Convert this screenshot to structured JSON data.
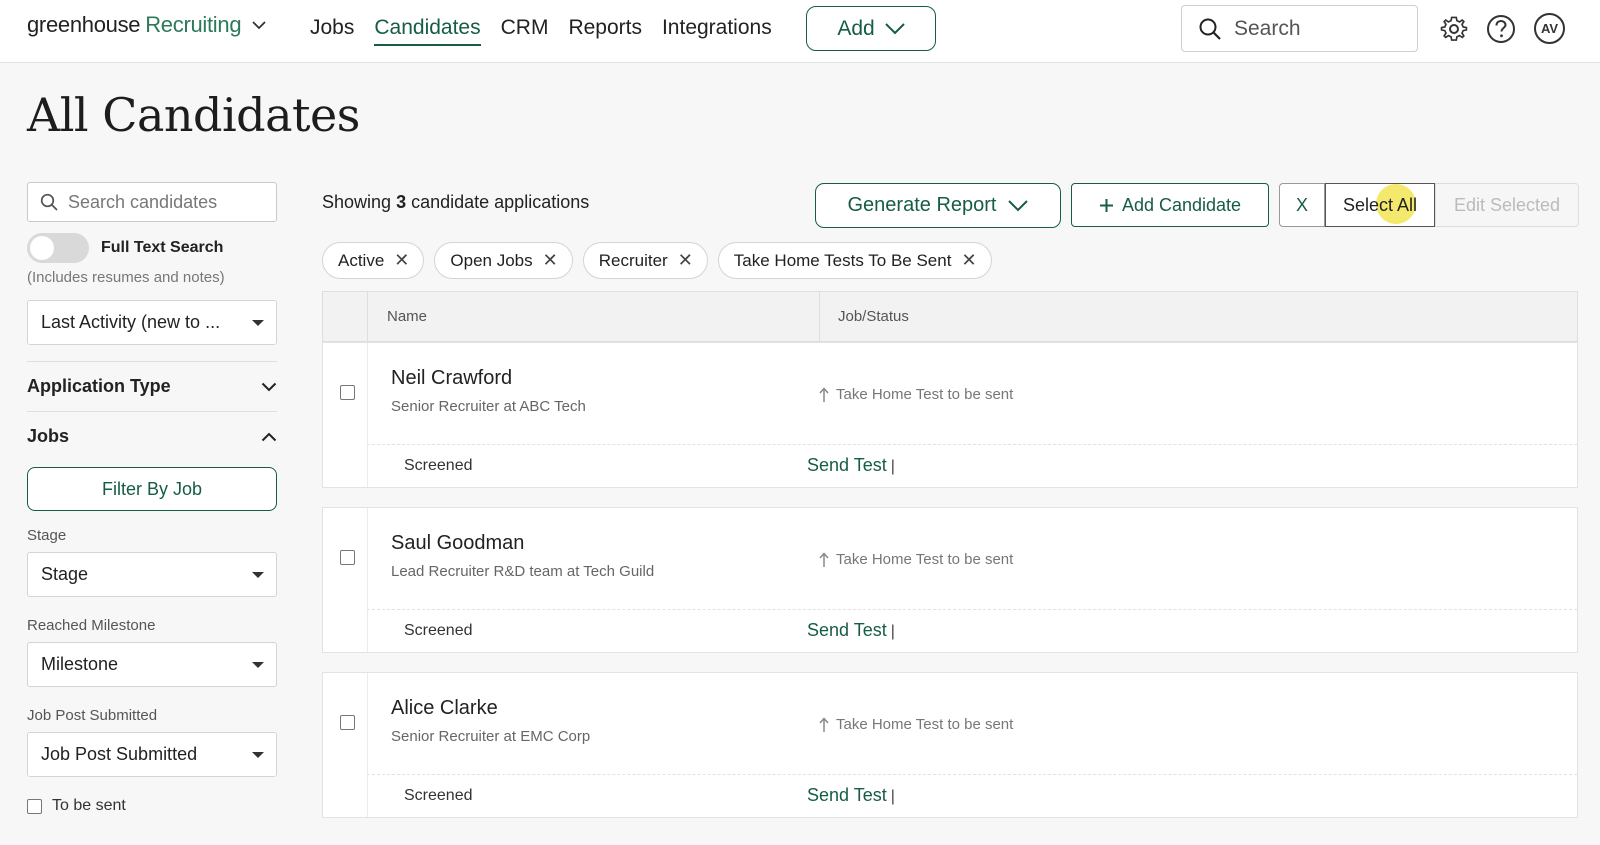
{
  "nav": {
    "logo_primary": "greenhouse",
    "logo_secondary": "Recruiting",
    "links": [
      "Jobs",
      "Candidates",
      "CRM",
      "Reports",
      "Integrations"
    ],
    "active_link": "Candidates",
    "add_label": "Add",
    "search_placeholder": "Search",
    "avatar_initials": "AV"
  },
  "page": {
    "title": "All Candidates"
  },
  "sidebar": {
    "search_placeholder": "Search candidates",
    "full_text_label": "Full Text Search",
    "full_text_note": "(Includes resumes and notes)",
    "sort_value": "Last Activity (new to ...",
    "application_type_label": "Application Type",
    "jobs_label": "Jobs",
    "filter_by_job_label": "Filter By Job",
    "stage_label": "Stage",
    "stage_value": "Stage",
    "milestone_label": "Reached Milestone",
    "milestone_value": "Milestone",
    "job_post_label": "Job Post Submitted",
    "job_post_value": "Job Post Submitted",
    "to_be_sent_label": "To be sent"
  },
  "main": {
    "showing_prefix": "Showing",
    "showing_count": "3",
    "showing_suffix": "candidate applications",
    "generate_report_label": "Generate Report",
    "add_candidate_label": "Add Candidate",
    "clear_label": "X",
    "select_all_label": "Select All",
    "edit_selected_label": "Edit Selected",
    "chips": [
      "Active",
      "Open Jobs",
      "Recruiter",
      "Take Home Tests To Be Sent"
    ],
    "columns": {
      "name": "Name",
      "job_status": "Job/Status"
    },
    "candidates": [
      {
        "name": "Neil Crawford",
        "title": "Senior Recruiter at ABC Tech",
        "status": "Take Home Test to be sent",
        "stage": "Screened",
        "action": "Send Test",
        "pipe": "|"
      },
      {
        "name": "Saul Goodman",
        "title": "Lead Recruiter R&D team at Tech Guild",
        "status": "Take Home Test to be sent",
        "stage": "Screened",
        "action": "Send Test",
        "pipe": "|"
      },
      {
        "name": "Alice Clarke",
        "title": "Senior Recruiter at EMC Corp",
        "status": "Take Home Test to be sent",
        "stage": "Screened",
        "action": "Send Test",
        "pipe": "|"
      }
    ]
  },
  "colors": {
    "brand": "#165c46",
    "logo_green": "#2c7a5b",
    "cursor_highlight": "#f0e13c"
  }
}
